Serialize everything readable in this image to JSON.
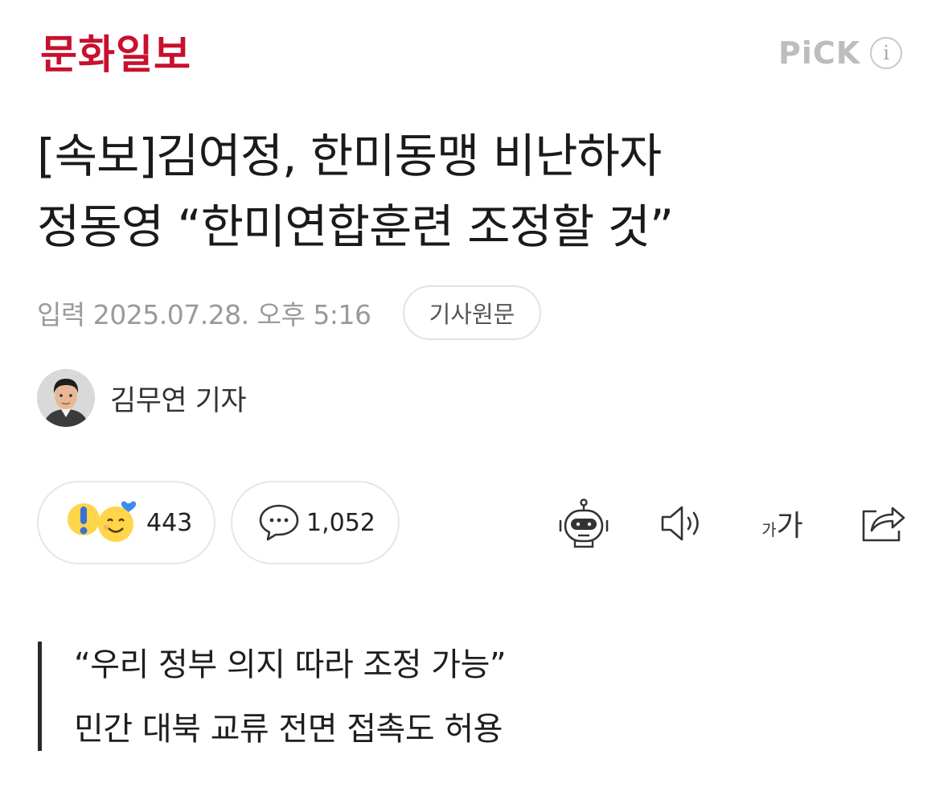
{
  "header": {
    "brand": "문화일보",
    "pick_label": "PiCK",
    "info_glyph": "i"
  },
  "headline": {
    "line1": "[속보]김여정, 한미동맹 비난하자",
    "line2": "정동영 “한미연합훈련 조정할 것”"
  },
  "meta": {
    "date_label": "입력",
    "date_value": "2025.07.28. 오후 5:16",
    "original_button": "기사원문"
  },
  "author": {
    "name": "김무연 기자"
  },
  "reactions": {
    "count": "443",
    "icons": [
      "exclamation-emoji-icon",
      "smile-heart-emoji-icon"
    ]
  },
  "comments": {
    "count": "1,052",
    "icon": "speech-bubble-icon"
  },
  "toolbar": {
    "icons": [
      "robot-summary-icon",
      "speaker-icon",
      "font-size-icon",
      "share-icon"
    ],
    "font_small": "가",
    "font_large": "가"
  },
  "subtitle": {
    "line1": "“우리 정부 의지 따라 조정 가능”",
    "line2": "민간 대북 교류 전면 접촉도 허용"
  },
  "colors": {
    "brand_red": "#c8102e",
    "muted_gray": "#9a9a9a",
    "border_gray": "#e6e6e6"
  }
}
